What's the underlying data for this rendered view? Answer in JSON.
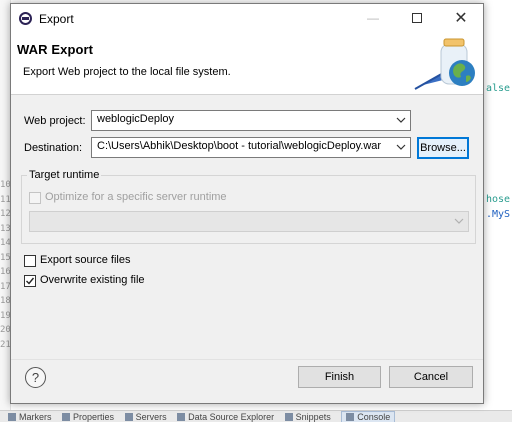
{
  "dialog": {
    "title": "Export",
    "banner_title": "WAR Export",
    "banner_description": "Export Web project to the local file system.",
    "window_controls": {
      "minimize": "—",
      "maximize": "",
      "close": "✕"
    }
  },
  "form": {
    "web_project_label": "Web project:",
    "web_project_value": "weblogicDeploy",
    "destination_label": "Destination:",
    "destination_value": "C:\\Users\\Abhik\\Desktop\\boot - tutorial\\weblogicDeploy.war",
    "browse_label": "Browse..."
  },
  "target_runtime": {
    "legend": "Target runtime",
    "optimize_label": "Optimize for a specific server runtime",
    "optimize_checked": false,
    "runtime_value": ""
  },
  "options": [
    {
      "label": "Export source files",
      "checked": false
    },
    {
      "label": "Overwrite existing file",
      "checked": true
    }
  ],
  "buttons": {
    "help": "?",
    "finish": "Finish",
    "cancel": "Cancel"
  },
  "editor": {
    "line_numbers": [
      "10",
      "11",
      "12",
      "13",
      "14",
      "15",
      "16",
      "17",
      "18",
      "19",
      "20",
      "21"
    ],
    "code_fragments": [
      "alse",
      "hose",
      ".MyS"
    ],
    "bottom_tabs": [
      "Markers",
      "Properties",
      "Servers",
      "Data Source Explorer",
      "Snippets",
      "Console"
    ]
  },
  "colors": {
    "accent": "#0078d7",
    "code_keyword": "#2a9d8f",
    "code_type": "#2060c0"
  }
}
